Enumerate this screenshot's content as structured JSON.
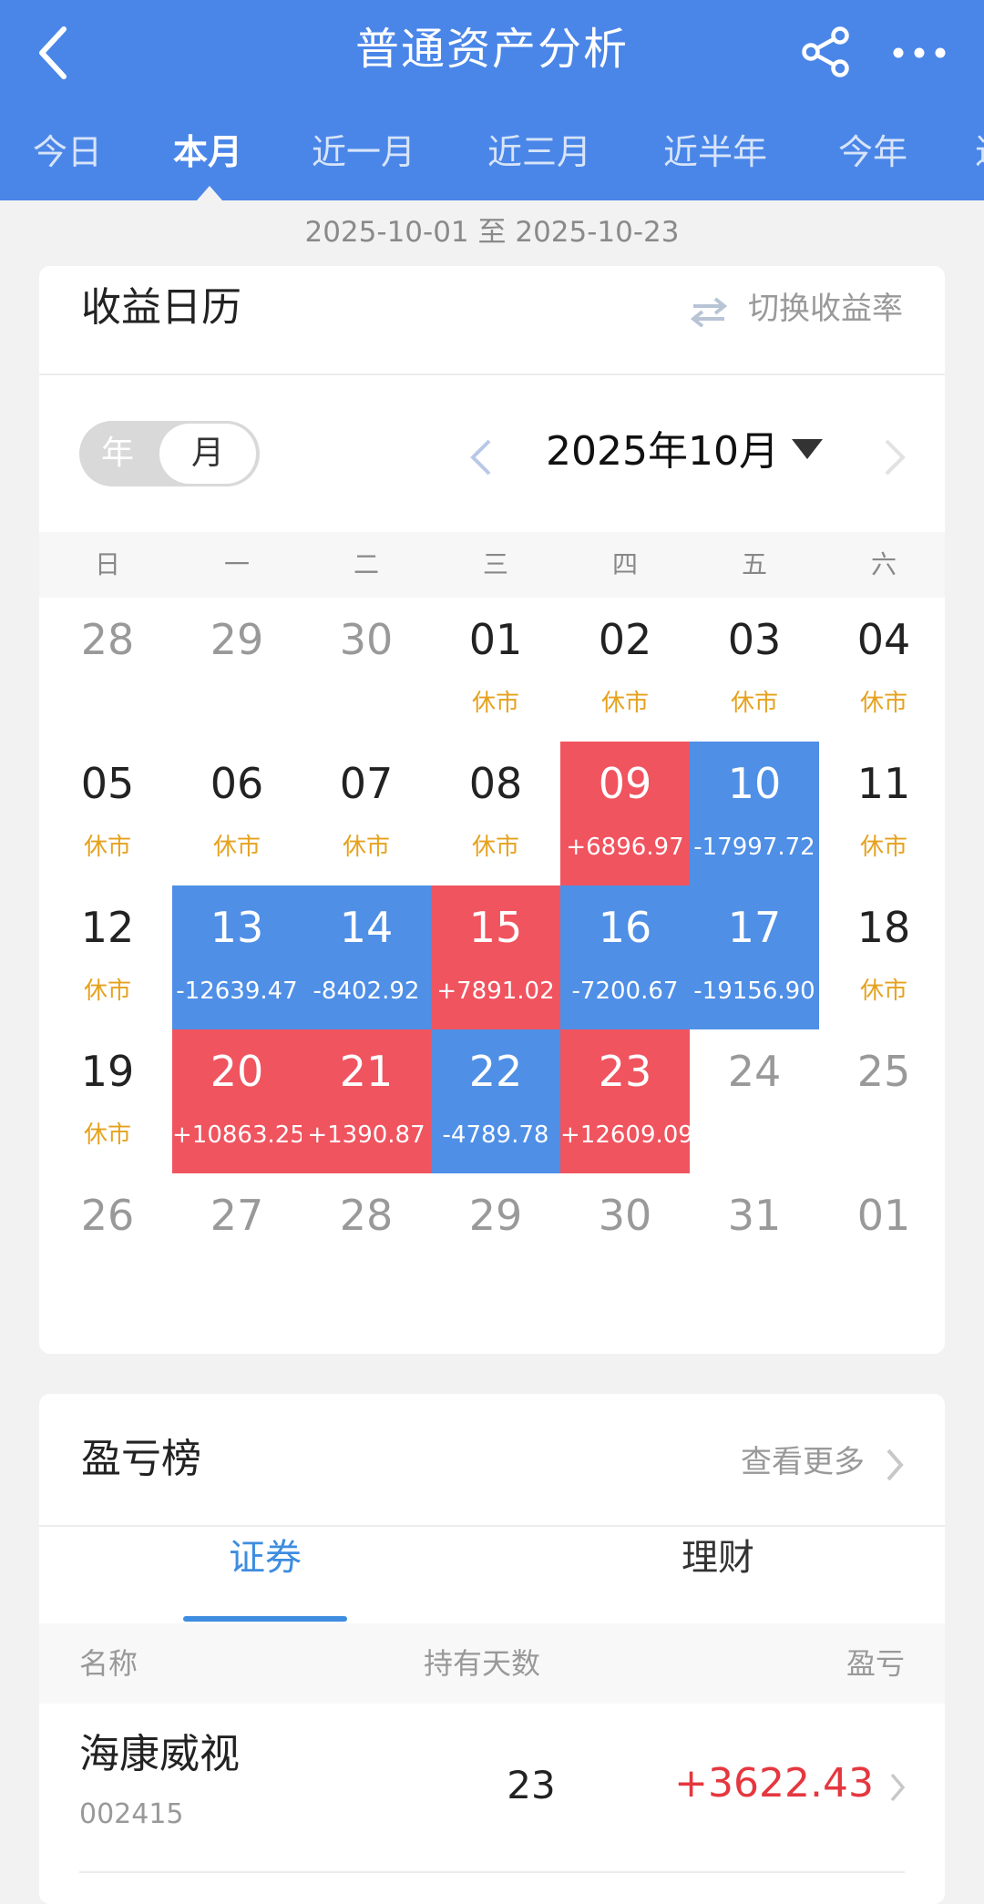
{
  "header": {
    "title": "普通资产分析",
    "tabs": [
      "今日",
      "本月",
      "近一月",
      "近三月",
      "近半年",
      "今年",
      "近"
    ],
    "active_tab": "本月"
  },
  "date_range": "2025-10-01 至 2025-10-23",
  "calendar_card": {
    "title": "收益日历",
    "switch_label": "切换收益率",
    "toggle": {
      "year": "年",
      "month": "月",
      "selected": "月"
    },
    "month_label": "2025年10月",
    "weekdays": [
      "日",
      "一",
      "二",
      "三",
      "四",
      "五",
      "六"
    ],
    "days": [
      {
        "d": "28",
        "other": true
      },
      {
        "d": "29",
        "other": true
      },
      {
        "d": "30",
        "other": true
      },
      {
        "d": "01",
        "sub": "休市"
      },
      {
        "d": "02",
        "sub": "休市"
      },
      {
        "d": "03",
        "sub": "休市"
      },
      {
        "d": "04",
        "sub": "休市"
      },
      {
        "d": "05",
        "sub": "休市"
      },
      {
        "d": "06",
        "sub": "休市"
      },
      {
        "d": "07",
        "sub": "休市"
      },
      {
        "d": "08",
        "sub": "休市"
      },
      {
        "d": "09",
        "sub": "+6896.97",
        "trend": "up"
      },
      {
        "d": "10",
        "sub": "-17997.72",
        "trend": "down"
      },
      {
        "d": "11",
        "sub": "休市"
      },
      {
        "d": "12",
        "sub": "休市"
      },
      {
        "d": "13",
        "sub": "-12639.47",
        "trend": "down"
      },
      {
        "d": "14",
        "sub": "-8402.92",
        "trend": "down"
      },
      {
        "d": "15",
        "sub": "+7891.02",
        "trend": "up"
      },
      {
        "d": "16",
        "sub": "-7200.67",
        "trend": "down"
      },
      {
        "d": "17",
        "sub": "-19156.90",
        "trend": "down"
      },
      {
        "d": "18",
        "sub": "休市"
      },
      {
        "d": "19",
        "sub": "休市"
      },
      {
        "d": "20",
        "sub": "+10863.25",
        "trend": "up"
      },
      {
        "d": "21",
        "sub": "+1390.87",
        "trend": "up"
      },
      {
        "d": "22",
        "sub": "-4789.78",
        "trend": "down"
      },
      {
        "d": "23",
        "sub": "+12609.09",
        "trend": "up"
      },
      {
        "d": "24",
        "other": true
      },
      {
        "d": "25",
        "other": true
      },
      {
        "d": "26",
        "other": true
      },
      {
        "d": "27",
        "other": true
      },
      {
        "d": "28",
        "other": true
      },
      {
        "d": "29",
        "other": true
      },
      {
        "d": "30",
        "other": true
      },
      {
        "d": "31",
        "other": true
      },
      {
        "d": "01",
        "other": true
      }
    ]
  },
  "profit_card": {
    "title": "盈亏榜",
    "more_label": "查看更多",
    "tabs": [
      "证券",
      "理财"
    ],
    "active_tab": "证券",
    "columns": [
      "名称",
      "持有天数",
      "盈亏"
    ],
    "rows": [
      {
        "name": "海康威视",
        "code": "002415",
        "days": "23",
        "pnl": "+3622.43"
      }
    ]
  },
  "colors": {
    "header": "#4a86e8",
    "gain": "#f0545f",
    "loss": "#4f8fe6",
    "holiday": "#e5a21e",
    "tab_active": "#3e8de0",
    "pnl_positive": "#e5373f"
  }
}
